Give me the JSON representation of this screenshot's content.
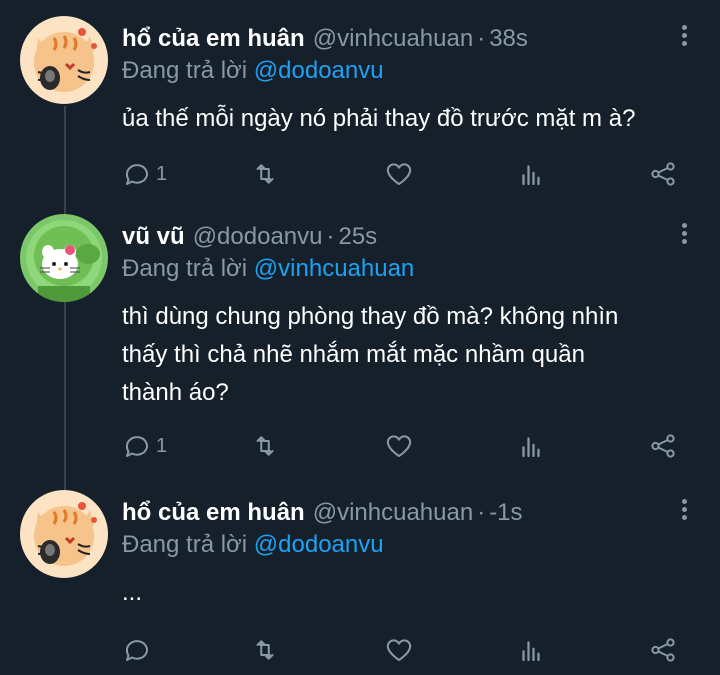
{
  "tweets": [
    {
      "display_name": "hổ của em huân",
      "handle": "@vinhcuahuan",
      "separator": "·",
      "time": "38s",
      "reply_prefix": "Đang trả lời",
      "reply_to": "@dodoanvu",
      "text_lines": [
        "ủa thế mỗi ngày nó phải thay đồ trước mặt m à?"
      ],
      "reply_count": "1",
      "avatar": "tiger-cat-icon"
    },
    {
      "display_name": "vũ vũ",
      "handle": "@dodoanvu",
      "separator": "·",
      "time": "25s",
      "reply_prefix": "Đang trả lời",
      "reply_to": "@vinhcuahuan",
      "text_lines": [
        "thì dùng chung phòng thay đồ mà? không nhìn",
        "thấy thì chả nhẽ nhắm mắt mặc nhầm quần",
        "thành áo?"
      ],
      "reply_count": "1",
      "avatar": "hello-kitty-peashooter-icon"
    },
    {
      "display_name": "hổ của em huân",
      "handle": "@vinhcuahuan",
      "separator": "·",
      "time": "-1s",
      "reply_prefix": "Đang trả lời",
      "reply_to": "@dodoanvu",
      "text_lines": [
        "..."
      ],
      "reply_count": "",
      "avatar": "tiger-cat-icon"
    }
  ],
  "colors": {
    "background": "#15202b",
    "primary_text": "#ffffff",
    "secondary_text": "#8899a6",
    "accent": "#1da1f2",
    "thread_line": "#38444d"
  }
}
